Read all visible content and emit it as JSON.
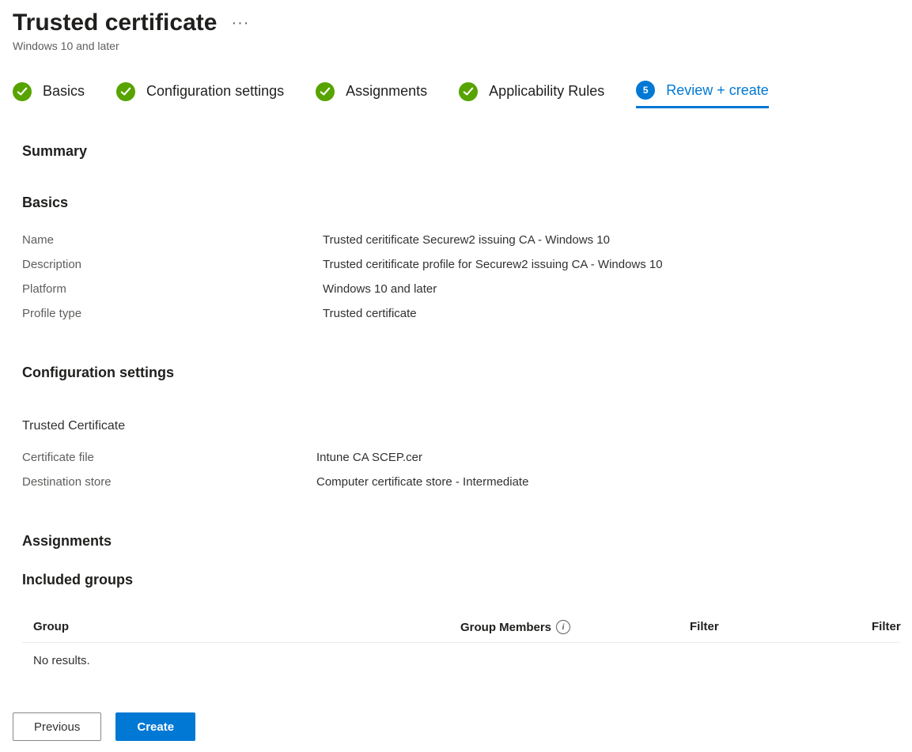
{
  "header": {
    "title": "Trusted certificate",
    "subtitle": "Windows 10 and later"
  },
  "steps": [
    {
      "label": "Basics",
      "state": "done"
    },
    {
      "label": "Configuration settings",
      "state": "done"
    },
    {
      "label": "Assignments",
      "state": "done"
    },
    {
      "label": "Applicability Rules",
      "state": "done"
    },
    {
      "label": "Review + create",
      "state": "current",
      "number": "5"
    }
  ],
  "summary_heading": "Summary",
  "basics": {
    "heading": "Basics",
    "rows": [
      {
        "label": "Name",
        "value": "Trusted ceritificate Securew2 issuing CA - Windows 10"
      },
      {
        "label": "Description",
        "value": "Trusted ceritificate profile for Securew2 issuing CA - Windows 10"
      },
      {
        "label": "Platform",
        "value": "Windows 10 and later"
      },
      {
        "label": "Profile type",
        "value": "Trusted certificate"
      }
    ]
  },
  "config": {
    "heading": "Configuration settings",
    "sub_heading": "Trusted Certificate",
    "rows": [
      {
        "label": "Certificate file",
        "value": "Intune CA SCEP.cer"
      },
      {
        "label": "Destination store",
        "value": "Computer certificate store - Intermediate"
      }
    ]
  },
  "assignments": {
    "heading": "Assignments",
    "included_heading": "Included groups",
    "columns": {
      "group": "Group",
      "members": "Group Members",
      "filter1": "Filter",
      "filter2": "Filter"
    },
    "empty": "No results."
  },
  "footer": {
    "previous": "Previous",
    "create": "Create"
  }
}
